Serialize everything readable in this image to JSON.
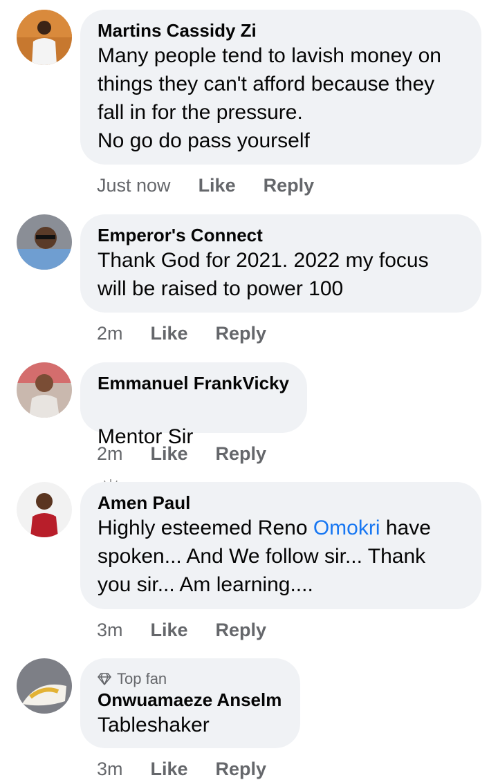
{
  "comments": [
    {
      "name": "Martins Cassidy Zi",
      "text": "Many people tend to lavish money on\nthings they can't afford because they\nfall in for the pressure.\nNo go do pass yourself",
      "time": "Just now",
      "like": "Like",
      "reply": "Reply"
    },
    {
      "name": "Emperor's Connect",
      "text": "Thank God for 2021. 2022 my focus\nwill be raised to power 100",
      "time": "2m",
      "like": "Like",
      "reply": "Reply"
    },
    {
      "name": "Emmanuel FrankVicky",
      "text": "Mentor Sir",
      "emoji": "raising-hands-emoji",
      "time": "2m",
      "like": "Like",
      "reply": "Reply"
    },
    {
      "name": "Amen Paul",
      "text_before": "Highly esteemed Reno ",
      "text_link": "Omokri",
      "text_after": " have\nspoken... And We follow sir... Thank\nyou sir... Am learning....",
      "time": "3m",
      "like": "Like",
      "reply": "Reply"
    },
    {
      "badge": "Top fan",
      "badge_icon": "diamond-icon",
      "name": "Onwuamaeze Anselm",
      "text": "Tableshaker",
      "time": "3m",
      "like": "Like",
      "reply": "Reply"
    }
  ],
  "colors": {
    "bubble": "#f0f2f5",
    "meta": "#65676b",
    "link": "#1877f2",
    "text": "#050505"
  }
}
